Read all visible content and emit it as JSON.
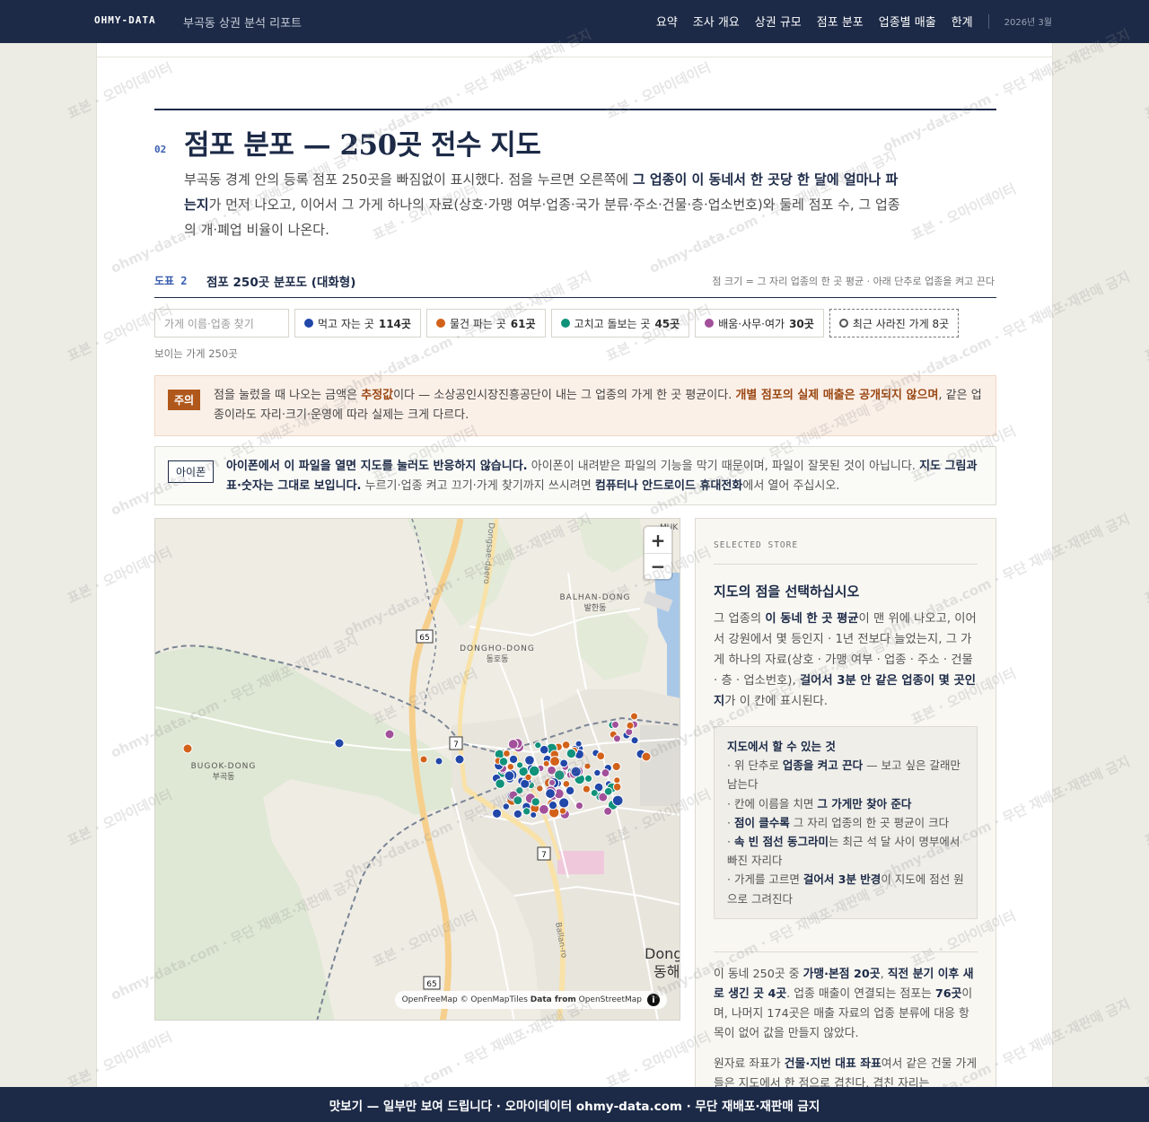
{
  "header": {
    "brand": "OHMY-DATA",
    "report_title": "부곡동 상권 분석 리포트",
    "nav": [
      "요약",
      "조사 개요",
      "상권 규모",
      "점포 분포",
      "업종별 매출",
      "한계"
    ],
    "date": "2026년 3월"
  },
  "section": {
    "number": "02",
    "title": "점포 분포 — 250곳 전수 지도",
    "lead_a": "부곡동 경계 안의 등록 점포 250곳을 빠짐없이 표시했다. 점을 누르면 오른쪽에 ",
    "lead_b": "그 업종이 이 동네서 한 곳당 한 달에 얼마나 파는지",
    "lead_c": "가 먼저 나오고, 이어서 그 가게 하나의 자료(상호·가맹 여부·업종·국가 분류·주소·건물·층·업소번호)와 둘레 점포 수, 그 업종의 개·폐업 비율이 나온다."
  },
  "figure": {
    "label": "도표 2",
    "title": "점포 250곳 분포도 (대화형)",
    "note": "점 크기 = 그 자리 업종의 한 곳 평균 · 아래 단추로 업종을 켜고 끈다"
  },
  "filters": {
    "search_placeholder": "가게 이름·업종 찾기",
    "chips": [
      {
        "label": "먹고 자는 곳",
        "count": "114곳",
        "color": "#2147a8"
      },
      {
        "label": "물건 파는 곳",
        "count": "61곳",
        "color": "#d2621a"
      },
      {
        "label": "고치고 돌보는 곳",
        "count": "45곳",
        "color": "#11927a"
      },
      {
        "label": "배움·사무·여가",
        "count": "30곳",
        "color": "#a2509a"
      }
    ],
    "closed_chip": "최근 사라진 가게 8곳",
    "visible_count": "보이는 가게 250곳"
  },
  "warning": {
    "tag": "주의",
    "t1": "점을 눌렀을 때 나오는 금액은 ",
    "t2": "추정값",
    "t3": "이다 — 소상공인시장진흥공단이 내는 그 업종의 가게 한 곳 평균이다. ",
    "t4": "개별 점포의 실제 매출은 공개되지 않으며",
    "t5": ", 같은 업종이라도 자리·크기·운영에 따라 실제는 크게 다르다."
  },
  "ios_notice": {
    "tag": "아이폰",
    "t1": "아이폰에서 이 파일을 열면 지도를 눌러도 반응하지 않습니다.",
    "t2": " 아이폰이 내려받은 파일의 기능을 막기 때문이며, 파일이 잘못된 것이 아닙니다. ",
    "t3": "지도 그림과 표·숫자는 그대로 보입니다.",
    "t4": " 누르기·업종 켜고 끄기·가게 찾기까지 쓰시려면 ",
    "t5": "컴퓨터나 안드로이드 휴대전화",
    "t6": "에서 열어 주십시오."
  },
  "map": {
    "labels": {
      "balhan_en": "BALHAN-DONG",
      "balhan_ko": "발한동",
      "dongho_en": "DONGHO-DONG",
      "dongho_ko": "동호동",
      "bugok_en": "BUGOK-DONG",
      "bugok_ko": "부곡동",
      "road_65a": "65",
      "road_65b": "65",
      "road_7a": "7",
      "road_7b": "7",
      "mukho": "MUK",
      "donghae_en": "Dong",
      "donghae_ko": "동해",
      "road_ballan": "Ballan-ro",
      "road_daero": "Dongsae-daero"
    },
    "zoom_in": "+",
    "zoom_out": "−",
    "attribution_a": "OpenFreeMap © OpenMapTiles ",
    "attribution_b": "Data from",
    "attribution_c": " OpenStreetMap",
    "info": "i"
  },
  "panel": {
    "kicker": "SELECTED STORE",
    "heading": "지도의 점을 선택하십시오",
    "d1": "그 업종의 ",
    "d2": "이 동네 한 곳 평균",
    "d3": "이 맨 위에 나오고, 이어서 강원에서 몇 등인지 · 1년 전보다 늘었는지, 그 가게 하나의 자료(상호 · 가맹 여부 · 업종 · 주소 · 건물 · 층 · 업소번호), ",
    "d4": "걸어서 3분 안 같은 업종이 몇 곳인지",
    "d5": "가 이 칸에 표시된다.",
    "howto_title": "지도에서 할 수 있는 것",
    "h1a": "· 위 단추로 ",
    "h1b": "업종을 켜고 끈다",
    "h1c": " — 보고 싶은 갈래만 남는다",
    "h2a": "· 칸에 이름을 치면 ",
    "h2b": "그 가게만 찾아 준다",
    "h3a": "· ",
    "h3b": "점이 클수록",
    "h3c": " 그 자리 업종의 한 곳 평균이 크다",
    "h4a": "· ",
    "h4b": "속 빈 점선 동그라미",
    "h4c": "는 최근 석 달 사이 명부에서 빠진 자리다",
    "h5a": "· 가게를 고르면 ",
    "h5b": "걸어서 3분 반경",
    "h5c": "이 지도에 점선 원으로 그려진다",
    "s1": "이 동네 250곳 중 ",
    "s2": "가맹·본점 20곳",
    "s3": ", ",
    "s4": "직전 분기 이후 새로 생긴 곳 4곳",
    "s5": ". 업종 매출이 연결되는 점포는 ",
    "s6": "76곳",
    "s7": "이며, 나머지 174곳은 매출 자료의 업종 분류에 대응 항목이 없어 값을 만들지 않았다.",
    "p1": "원자료 좌표가 ",
    "p2": "건물·지번 대표 좌표",
    "p3": "여서 같은 건물 가게들은 지도에서 한 점으로 겹친다. 겹친 자리는"
  },
  "watermark": "표본 · 오마이데이터",
  "watermark2": "ohmy-data.com · 무단 재배포·재판매 금지",
  "footer": "맛보기 — 일부만 보여 드립니다 · 오마이데이터 ohmy-data.com · 무단 재배포·재판매 금지",
  "colors": {
    "navy": "#1c2a47",
    "food": "#2147a8",
    "retail": "#d2621a",
    "service": "#11927a",
    "edu": "#a2509a"
  }
}
